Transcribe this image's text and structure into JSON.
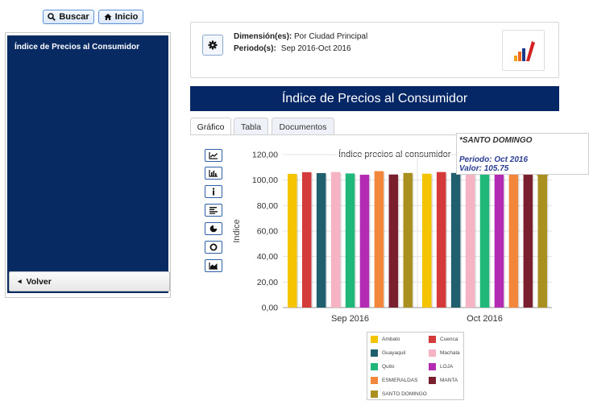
{
  "toolbar": {
    "search_label": "Buscar",
    "home_label": "Inicio"
  },
  "sidebar": {
    "title": "Índice de Precios al Consumidor",
    "back_label": "Volver"
  },
  "info": {
    "dimension_label": "Dimensión(es):",
    "dimension_value": "Por Ciudad Principal",
    "period_label": "Periodo(s):",
    "period_value": "Sep 2016-Oct 2016"
  },
  "page_title": "Índice de Precios al Consumidor",
  "tabs": [
    {
      "label": "Gráfico",
      "active": true
    },
    {
      "label": "Tabla",
      "active": false
    },
    {
      "label": "Documentos",
      "active": false
    }
  ],
  "chart_type_buttons": [
    "line-chart-icon",
    "bar-chart-icon",
    "info-icon",
    "horizontal-bar-icon",
    "pie-chart-icon",
    "donut-chart-icon",
    "area-chart-icon"
  ],
  "tooltip": {
    "title": "*SANTO DOMINGO",
    "period_label": "Periodo:",
    "period_value": "Oct 2016",
    "value_label": "Valor:",
    "value_value": "105.75"
  },
  "chart_data": {
    "type": "bar",
    "title": "Índice precios al consumidor",
    "xlabel": "",
    "ylabel": "Indice",
    "ylim": [
      0,
      120
    ],
    "yticks": [
      "0,00",
      "20,00",
      "40,00",
      "60,00",
      "80,00",
      "100,00",
      "120,00"
    ],
    "categories": [
      "Sep 2016",
      "Oct 2016"
    ],
    "series": [
      {
        "name": "Ambato",
        "color": "#f5c400",
        "values": [
          104.9,
          105.0
        ]
      },
      {
        "name": "Cuenca",
        "color": "#d43a3a",
        "values": [
          106.2,
          106.3
        ]
      },
      {
        "name": "Guayaquil",
        "color": "#1f5f6e",
        "values": [
          105.5,
          105.6
        ]
      },
      {
        "name": "Machala",
        "color": "#f6b3c3",
        "values": [
          106.3,
          106.4
        ]
      },
      {
        "name": "Quito",
        "color": "#1fb87a",
        "values": [
          105.2,
          105.3
        ]
      },
      {
        "name": "LOJA",
        "color": "#b32bb3",
        "values": [
          104.2,
          104.3
        ]
      },
      {
        "name": "ESMERALDAS",
        "color": "#f2863a",
        "values": [
          107.0,
          107.1
        ]
      },
      {
        "name": "MANTA",
        "color": "#7a1f2e",
        "values": [
          104.4,
          104.5
        ]
      },
      {
        "name": "SANTO DOMINGO",
        "color": "#a99020",
        "values": [
          105.6,
          105.75
        ]
      }
    ],
    "grid": true,
    "legend_position": "bottom"
  }
}
